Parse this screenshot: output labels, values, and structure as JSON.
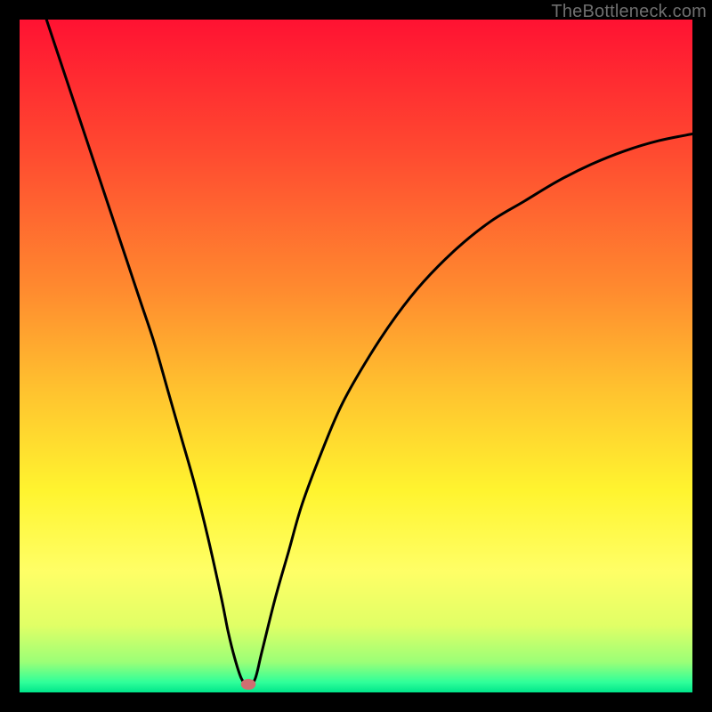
{
  "watermark": "TheBottleneck.com",
  "chart_data": {
    "type": "line",
    "title": "",
    "xlabel": "",
    "ylabel": "",
    "xlim": [
      0,
      100
    ],
    "ylim": [
      0,
      100
    ],
    "grid": false,
    "legend": false,
    "background_gradient": {
      "orientation": "vertical",
      "stops": [
        {
          "offset": 0.0,
          "color": "#ff1232"
        },
        {
          "offset": 0.2,
          "color": "#ff4b30"
        },
        {
          "offset": 0.4,
          "color": "#ff8a2f"
        },
        {
          "offset": 0.55,
          "color": "#ffc22f"
        },
        {
          "offset": 0.7,
          "color": "#fff42f"
        },
        {
          "offset": 0.82,
          "color": "#ffff66"
        },
        {
          "offset": 0.9,
          "color": "#e1ff66"
        },
        {
          "offset": 0.955,
          "color": "#9bff77"
        },
        {
          "offset": 0.985,
          "color": "#2fff9a"
        },
        {
          "offset": 1.0,
          "color": "#00e58a"
        }
      ]
    },
    "series": [
      {
        "name": "bottleneck-curve",
        "color": "#000000",
        "x": [
          4,
          6,
          8,
          10,
          12,
          14,
          16,
          18,
          20,
          22,
          24,
          26,
          28,
          30,
          31,
          32,
          33,
          34,
          35,
          36,
          38,
          40,
          42,
          45,
          48,
          52,
          56,
          60,
          65,
          70,
          75,
          80,
          85,
          90,
          95,
          100
        ],
        "y": [
          100,
          94,
          88,
          82,
          76,
          70,
          64,
          58,
          52,
          45,
          38,
          31,
          23,
          14,
          9,
          5,
          2,
          1,
          2,
          6,
          14,
          21,
          28,
          36,
          43,
          50,
          56,
          61,
          66,
          70,
          73,
          76,
          78.5,
          80.5,
          82,
          83
        ]
      }
    ],
    "marker": {
      "name": "optimal-point",
      "x": 34,
      "y": 1.2,
      "rx": 1.1,
      "ry": 0.8,
      "color": "#cf6f71"
    }
  }
}
